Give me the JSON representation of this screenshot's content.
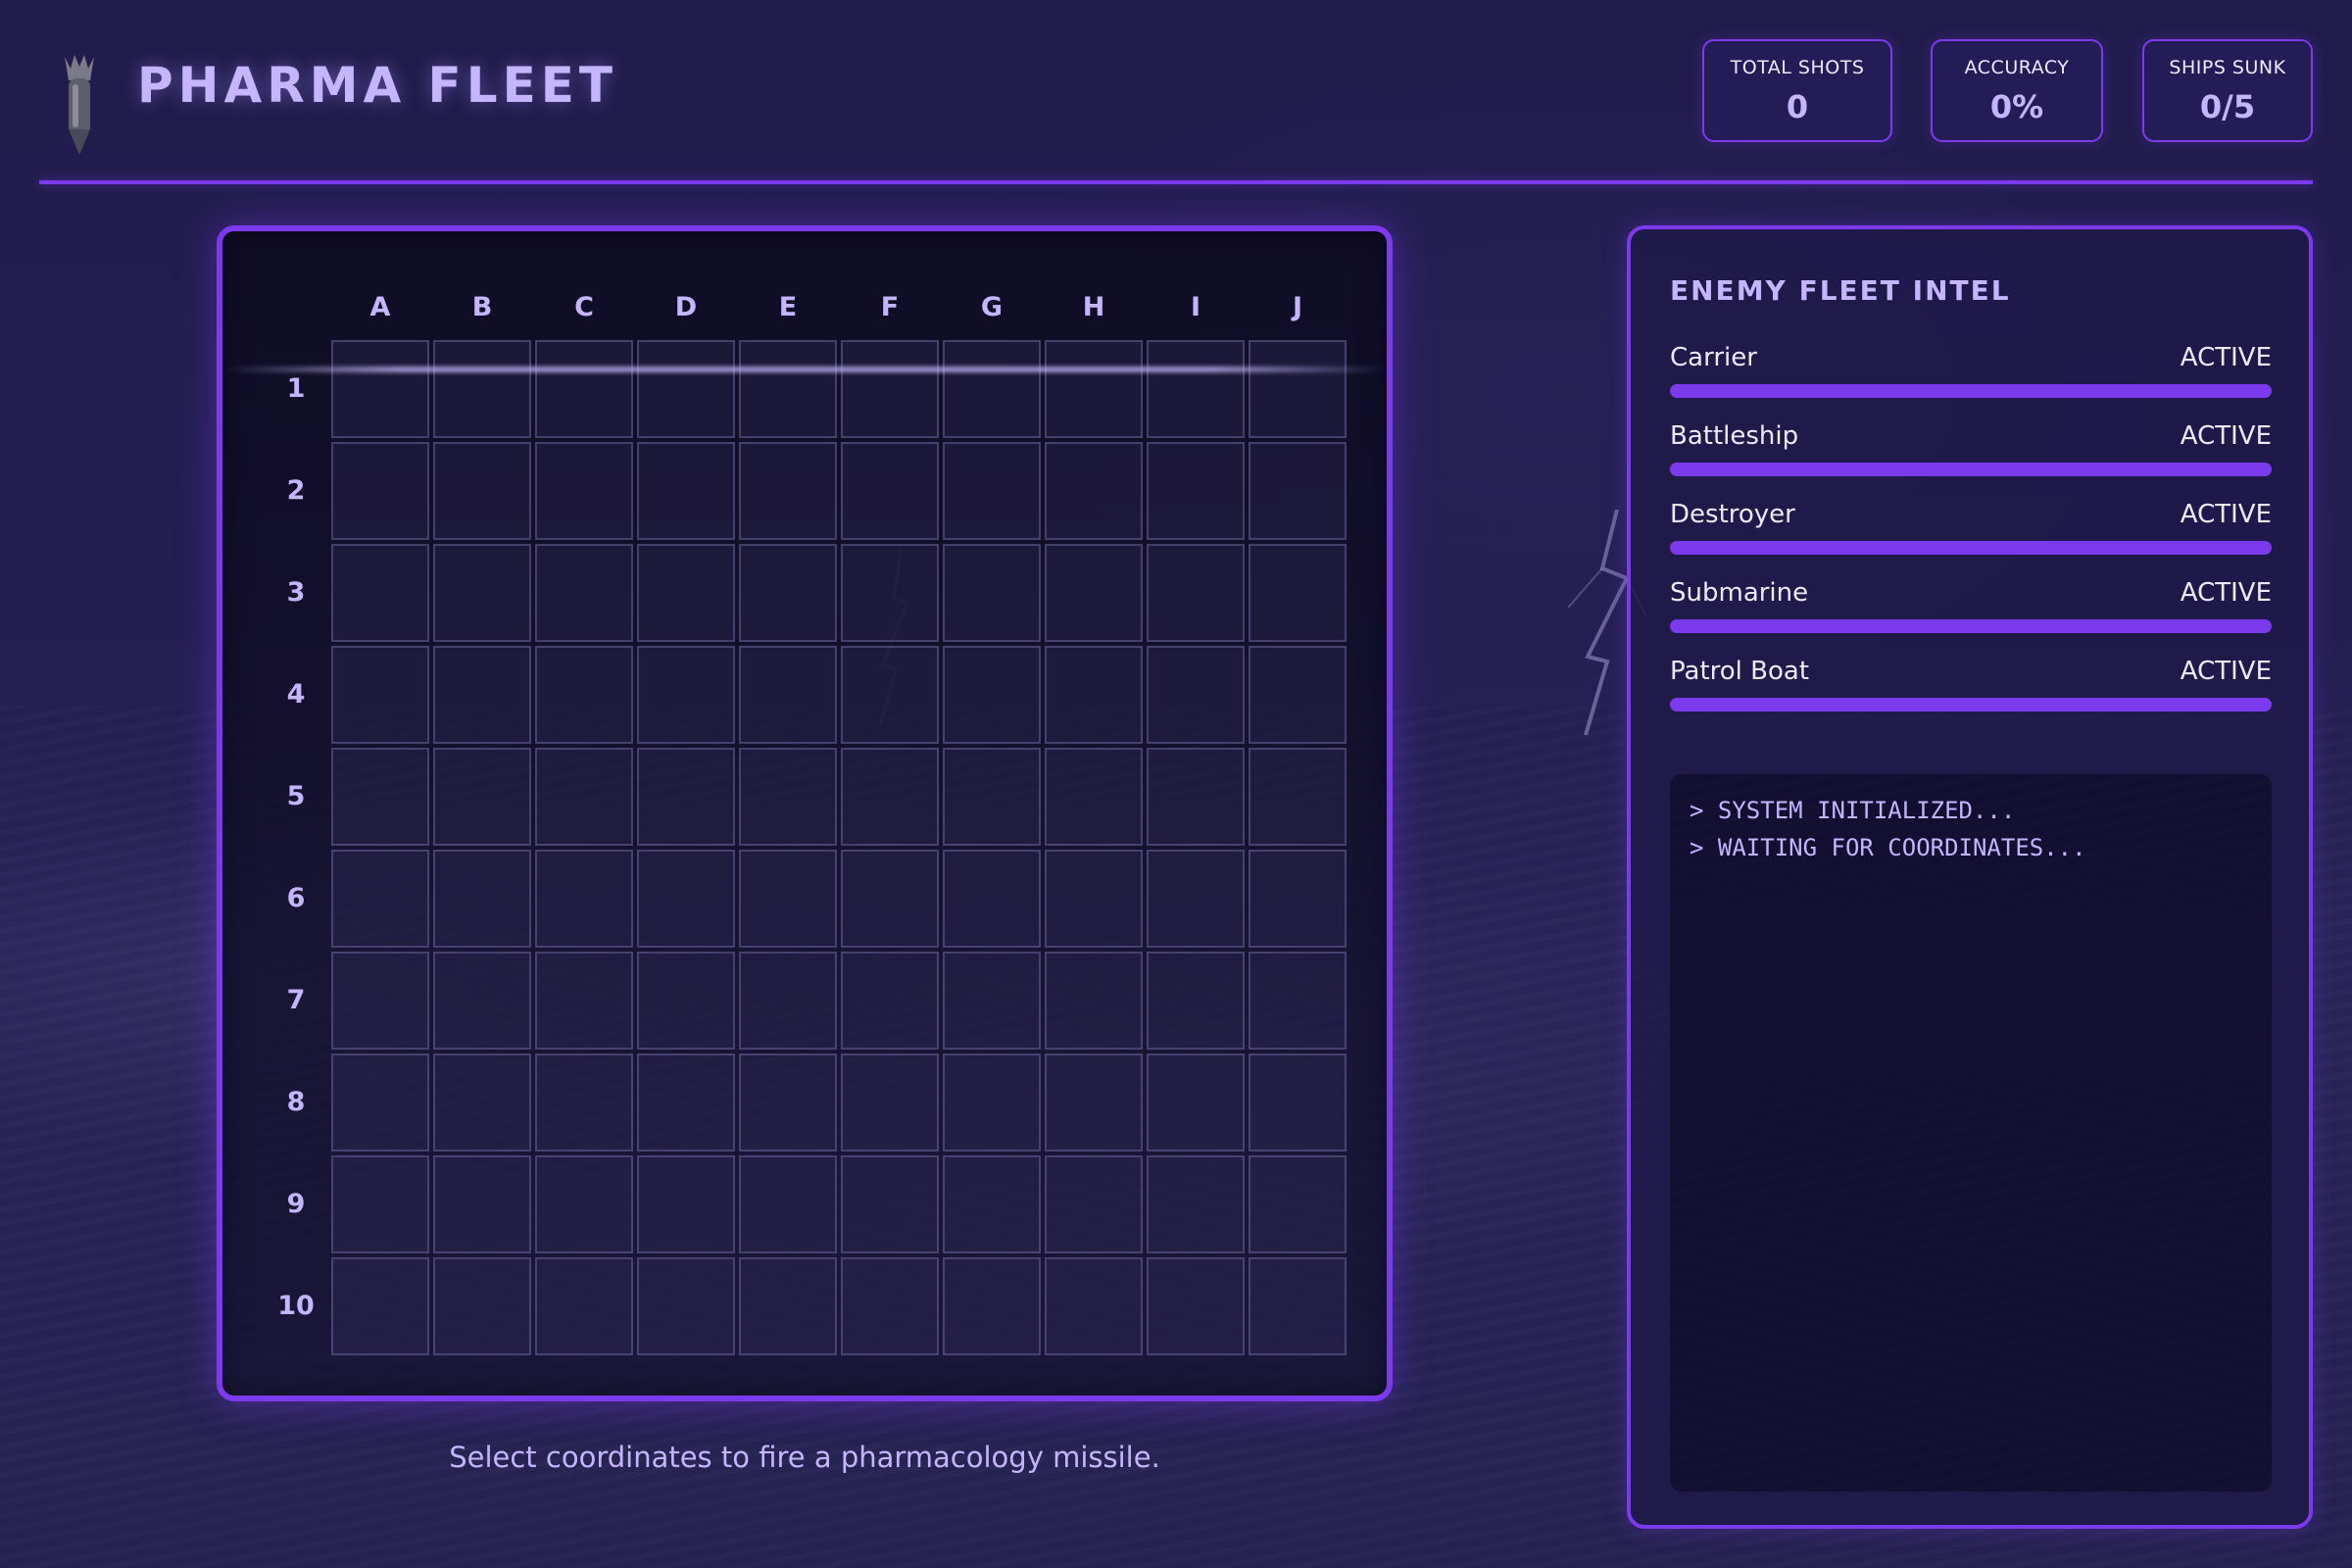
{
  "app": {
    "title": "PHARMA FLEET",
    "logo_icon": "pill-missile-icon"
  },
  "stats": [
    {
      "label": "TOTAL SHOTS",
      "value": "0"
    },
    {
      "label": "ACCURACY",
      "value": "0%"
    },
    {
      "label": "SHIPS SUNK",
      "value": "0/5"
    }
  ],
  "board": {
    "columns": [
      "A",
      "B",
      "C",
      "D",
      "E",
      "F",
      "G",
      "H",
      "I",
      "J"
    ],
    "rows": [
      "1",
      "2",
      "3",
      "4",
      "5",
      "6",
      "7",
      "8",
      "9",
      "10"
    ],
    "instruction": "Select coordinates to fire a pharmacology missile."
  },
  "intel": {
    "title": "ENEMY FLEET INTEL",
    "ships": [
      {
        "name": "Carrier",
        "status": "ACTIVE",
        "health": 1.0
      },
      {
        "name": "Battleship",
        "status": "ACTIVE",
        "health": 1.0
      },
      {
        "name": "Destroyer",
        "status": "ACTIVE",
        "health": 1.0
      },
      {
        "name": "Submarine",
        "status": "ACTIVE",
        "health": 1.0
      },
      {
        "name": "Patrol Boat",
        "status": "ACTIVE",
        "health": 1.0
      }
    ],
    "log": [
      "> SYSTEM INITIALIZED...",
      "> WAITING FOR COORDINATES..."
    ]
  },
  "colors": {
    "accent": "#7c3aed",
    "accent_light": "#c4b5fd",
    "background": "#1f1b45"
  }
}
